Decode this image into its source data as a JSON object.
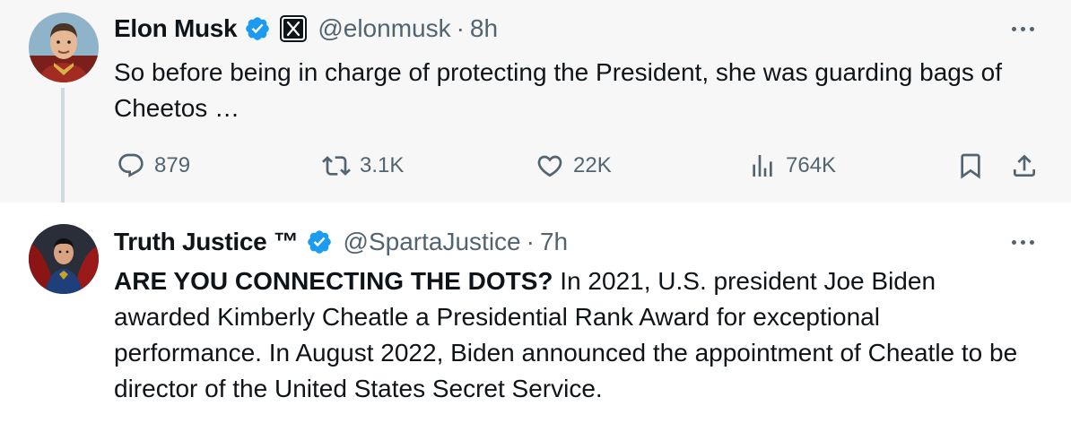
{
  "tweets": [
    {
      "author_name": "Elon Musk",
      "handle": "@elonmusk",
      "separator": "·",
      "time": "8h",
      "text": "So before being in charge of protecting the President, she was guarding bags of Cheetos …",
      "stats": {
        "replies": "879",
        "reposts": "3.1K",
        "likes": "22K",
        "views": "764K"
      }
    },
    {
      "author_name": "Truth Justice ™",
      "handle": "@SpartaJustice",
      "separator": "·",
      "time": "7h",
      "text_lead": "ARE YOU CONNECTING THE DOTS?",
      "text_rest": " In 2021, U.S. president Joe Biden awarded Kimberly Cheatle a Presidential Rank Award for exceptional performance. In August 2022, Biden announced the appointment of Cheatle to be director of the United States Secret Service."
    }
  ],
  "icons": {
    "verified": "verified-badge-icon",
    "affiliation": "x-logo-icon",
    "more": "more-icon",
    "reply": "reply-icon",
    "repost": "repost-icon",
    "like": "heart-icon",
    "views": "views-icon",
    "bookmark": "bookmark-icon",
    "share": "share-icon"
  },
  "colors": {
    "verified_blue": "#1d9bf0",
    "text_primary": "#0f1419",
    "text_secondary": "#536471",
    "thread_line": "#cfd9de",
    "highlight_background": "#f7f7f7"
  }
}
